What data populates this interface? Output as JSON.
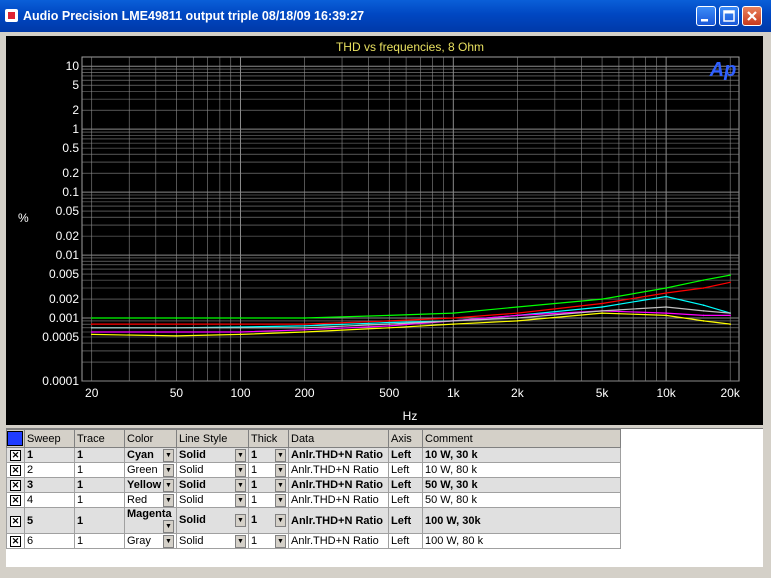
{
  "window": {
    "title": "Audio Precision  LME49811 output triple  08/18/09 16:39:27"
  },
  "chart_data": {
    "type": "line",
    "title": "THD vs frequencies, 8 Ohm",
    "xlabel": "Hz",
    "ylabel": "%",
    "x_scale": "log",
    "y_scale": "log",
    "xlim": [
      18,
      22000
    ],
    "ylim": [
      0.0001,
      14
    ],
    "x_ticks": [
      "20",
      "50",
      "100",
      "200",
      "500",
      "1k",
      "2k",
      "5k",
      "10k",
      "20k"
    ],
    "y_ticks": [
      "10",
      "5",
      "2",
      "1",
      "0.5",
      "0.2",
      "0.1",
      "0.05",
      "0.02",
      "0.01",
      "0.005",
      "0.002",
      "0.001",
      "0.0005",
      "0.0001"
    ],
    "grid": true,
    "logo": "Ap",
    "series": [
      {
        "color": "#00ffff",
        "x": [
          20,
          50,
          100,
          200,
          500,
          1000,
          2000,
          5000,
          10000,
          15000,
          20000
        ],
        "y": [
          0.0007,
          0.0007,
          0.00072,
          0.00075,
          0.00085,
          0.0009,
          0.0011,
          0.0015,
          0.0022,
          0.0016,
          0.0012
        ]
      },
      {
        "color": "#00ff00",
        "x": [
          20,
          50,
          100,
          200,
          500,
          1000,
          2000,
          5000,
          10000,
          15000,
          20000
        ],
        "y": [
          0.001,
          0.001,
          0.001,
          0.001,
          0.0011,
          0.0012,
          0.0015,
          0.002,
          0.003,
          0.004,
          0.0048
        ]
      },
      {
        "color": "#ffff00",
        "x": [
          20,
          50,
          100,
          200,
          500,
          1000,
          2000,
          5000,
          10000,
          15000,
          20000
        ],
        "y": [
          0.00055,
          0.00052,
          0.00055,
          0.0006,
          0.0007,
          0.0008,
          0.0009,
          0.0012,
          0.0011,
          0.0009,
          0.0008
        ]
      },
      {
        "color": "#ff0000",
        "x": [
          20,
          50,
          100,
          200,
          500,
          1000,
          2000,
          5000,
          10000,
          15000,
          20000
        ],
        "y": [
          0.0008,
          0.0008,
          0.0008,
          0.0008,
          0.0009,
          0.001,
          0.0012,
          0.0017,
          0.0025,
          0.003,
          0.0037
        ]
      },
      {
        "color": "#ff00ff",
        "x": [
          20,
          50,
          100,
          200,
          500,
          1000,
          2000,
          5000,
          10000,
          15000,
          20000
        ],
        "y": [
          0.0006,
          0.0006,
          0.0006,
          0.00065,
          0.00075,
          0.0009,
          0.0011,
          0.0013,
          0.0012,
          0.0011,
          0.0011
        ]
      },
      {
        "color": "#c0c0c0",
        "x": [
          20,
          50,
          100,
          200,
          500,
          1000,
          2000,
          5000,
          10000,
          15000,
          20000
        ],
        "y": [
          0.0007,
          0.0007,
          0.0007,
          0.0007,
          0.0008,
          0.0009,
          0.001,
          0.0013,
          0.0015,
          0.0013,
          0.0012
        ]
      }
    ]
  },
  "table": {
    "headers": [
      "",
      "Sweep",
      "Trace",
      "Color",
      "Line Style",
      "Thick",
      "Data",
      "Axis",
      "Comment"
    ],
    "rows": [
      {
        "bold": true,
        "sweep": "1",
        "trace": "1",
        "color": "Cyan",
        "style": "Solid",
        "thick": "1",
        "data": "Anlr.THD+N Ratio",
        "axis": "Left",
        "comment": "10 W, 30 k"
      },
      {
        "bold": false,
        "sweep": "2",
        "trace": "1",
        "color": "Green",
        "style": "Solid",
        "thick": "1",
        "data": "Anlr.THD+N Ratio",
        "axis": "Left",
        "comment": "10 W, 80 k"
      },
      {
        "bold": true,
        "sweep": "3",
        "trace": "1",
        "color": "Yellow",
        "style": "Solid",
        "thick": "1",
        "data": "Anlr.THD+N Ratio",
        "axis": "Left",
        "comment": "50 W, 30 k"
      },
      {
        "bold": false,
        "sweep": "4",
        "trace": "1",
        "color": "Red",
        "style": "Solid",
        "thick": "1",
        "data": "Anlr.THD+N Ratio",
        "axis": "Left",
        "comment": "50 W, 80 k"
      },
      {
        "bold": true,
        "sweep": "5",
        "trace": "1",
        "color": "Magenta",
        "style": "Solid",
        "thick": "1",
        "data": "Anlr.THD+N Ratio",
        "axis": "Left",
        "comment": "100 W, 30k"
      },
      {
        "bold": false,
        "sweep": "6",
        "trace": "1",
        "color": "Gray",
        "style": "Solid",
        "thick": "1",
        "data": "Anlr.THD+N Ratio",
        "axis": "Left",
        "comment": "100 W, 80 k"
      }
    ]
  }
}
